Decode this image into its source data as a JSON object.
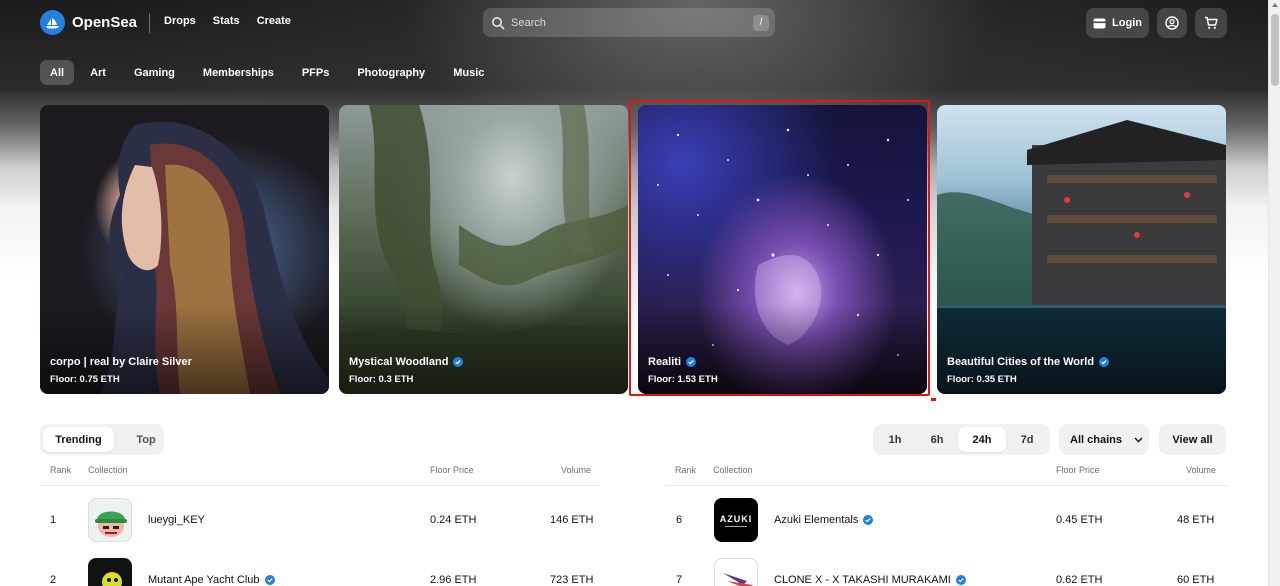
{
  "brand": {
    "name": "OpenSea"
  },
  "nav": [
    "Drops",
    "Stats",
    "Create"
  ],
  "search": {
    "placeholder": "Search",
    "shortcut": "/"
  },
  "header_buttons": {
    "login": "Login"
  },
  "categories": [
    "All",
    "Art",
    "Gaming",
    "Memberships",
    "PFPs",
    "Photography",
    "Music"
  ],
  "active_category": "All",
  "featured": [
    {
      "title": "corpo | real by Claire Silver",
      "floor": "Floor: 0.75 ETH",
      "verified": false
    },
    {
      "title": "Mystical Woodland",
      "floor": "Floor: 0.3 ETH",
      "verified": true
    },
    {
      "title": "Realiti",
      "floor": "Floor: 1.53 ETH",
      "verified": true
    },
    {
      "title": "Beautiful Cities of the World",
      "floor": "Floor: 0.35 ETH",
      "verified": true
    }
  ],
  "trending_tabs": [
    "Trending",
    "Top"
  ],
  "time_tabs": [
    "1h",
    "6h",
    "24h",
    "7d"
  ],
  "active_time": "24h",
  "chains_label": "All chains",
  "view_all": "View all",
  "table_headers": {
    "rank": "Rank",
    "collection": "Collection",
    "floor": "Floor Price",
    "volume": "Volume"
  },
  "left_rows": [
    {
      "rank": "1",
      "name": "lueygi_KEY",
      "floor": "0.24 ETH",
      "volume": "146 ETH",
      "verified": false
    },
    {
      "rank": "2",
      "name": "Mutant Ape Yacht Club",
      "floor": "2.96 ETH",
      "volume": "723 ETH",
      "verified": true
    }
  ],
  "right_rows": [
    {
      "rank": "6",
      "name": "Azuki Elementals",
      "floor": "0.45 ETH",
      "volume": "48 ETH",
      "verified": true,
      "thumb_text": "AZUKI"
    },
    {
      "rank": "7",
      "name": "CLONE X - X TAKASHI MURAKAMI",
      "floor": "0.62 ETH",
      "volume": "60 ETH",
      "verified": true
    }
  ],
  "colors": {
    "accent": "#2081e2",
    "highlight": "#e01616"
  }
}
